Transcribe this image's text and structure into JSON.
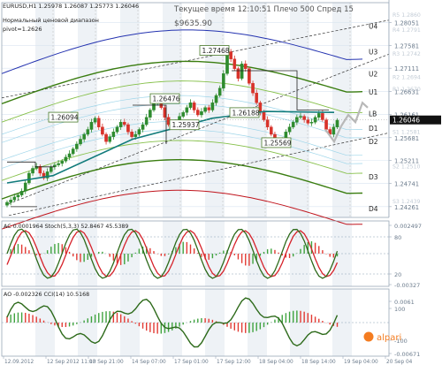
{
  "colors": {
    "bull": "#2e8b2e",
    "bear": "#d8322a",
    "up_wick": "#2e8b2e",
    "grid": "#d9e4f0",
    "band_outer": "#2433b0",
    "band_green": "#3a7d10",
    "band_red": "#c0141c",
    "lb_teal": "#117b7b",
    "label_border": "#4a7a2a",
    "axis_text": "#6b7b8c"
  },
  "header": {
    "symbol_line": "EURUSD,H1  1.25978 1.26087 1.25773 1.26046",
    "indicator_name": "Нормальный ценовой диапазон",
    "pivot_line": "pivot=1.2626",
    "top_info": "Текущее время 12:10:51 Плечо 500 Спред 15",
    "balance": "$9635.90"
  },
  "level_labels": [
    "U4",
    "U3",
    "U2",
    "U1",
    "LB",
    "D1",
    "D2",
    "D3",
    "D4"
  ],
  "price_labels": [
    {
      "text": "R5 1.2860",
      "kind": "faint"
    },
    {
      "text": "1.28051",
      "kind": "tick"
    },
    {
      "text": "R4 1.2791",
      "kind": "faint"
    },
    {
      "text": "1.27581",
      "kind": "tick"
    },
    {
      "text": "R3 1.2742",
      "kind": "faint"
    },
    {
      "text": "1.27111",
      "kind": "tick"
    },
    {
      "text": "R2 1.2694",
      "kind": "faint"
    },
    {
      "text": "1.26631",
      "kind": "tick"
    },
    {
      "text": "R1 1.2670",
      "kind": "faint"
    },
    {
      "text": "1.26161",
      "kind": "tick"
    },
    {
      "text": "1.26046",
      "kind": "current"
    },
    {
      "text": "1.25681",
      "kind": "tick"
    },
    {
      "text": "S1 1.2581",
      "kind": "faint"
    },
    {
      "text": "1.25211",
      "kind": "tick"
    },
    {
      "text": "S2 1.2510",
      "kind": "faint"
    },
    {
      "text": "1.24741",
      "kind": "tick"
    },
    {
      "text": "S3 1.2439",
      "kind": "faint"
    },
    {
      "text": "1.24261",
      "kind": "tick"
    }
  ],
  "callouts": [
    {
      "text": "1.27468"
    },
    {
      "text": "1.26094"
    },
    {
      "text": "1.26476"
    },
    {
      "text": "1.25937"
    },
    {
      "text": "1.26188"
    },
    {
      "text": "1.25569"
    }
  ],
  "chart_data": {
    "type": "line",
    "title": "EURUSD,H1",
    "last_price": 1.26046,
    "pivot": 1.2626,
    "pivot_levels": {
      "R5": 1.286,
      "R4": 1.2791,
      "R3": 1.2742,
      "R2": 1.2694,
      "R1": 1.267,
      "S1": 1.2581,
      "S2": 1.251,
      "S3": 1.2439
    },
    "price_ticks": [
      1.28051,
      1.27581,
      1.27111,
      1.26631,
      1.26161,
      1.25681,
      1.25211,
      1.24741,
      1.24261
    ],
    "ylim": [
      1.2404,
      1.2846
    ],
    "series": [
      {
        "values": [
          1.2435,
          1.244,
          1.2446,
          1.245,
          1.2458,
          1.2475,
          1.2495,
          1.2505,
          1.2509,
          1.2495,
          1.2485,
          1.2498,
          1.2508,
          1.2512,
          1.2515,
          1.252,
          1.2528,
          1.2535,
          1.2545,
          1.2555,
          1.2565,
          1.2575,
          1.2585,
          1.26,
          1.2608,
          1.259,
          1.2575,
          1.256,
          1.257,
          1.258,
          1.259,
          1.26,
          1.2595,
          1.258,
          1.257,
          1.2575,
          1.2585,
          1.2595,
          1.261,
          1.2625,
          1.264,
          1.2645,
          1.263,
          1.261,
          1.2595,
          1.259,
          1.26,
          1.2612,
          1.262,
          1.263,
          1.264,
          1.2625,
          1.2615,
          1.2622,
          1.263,
          1.2625,
          1.264,
          1.2655,
          1.267,
          1.27,
          1.2745,
          1.273,
          1.271,
          1.269,
          1.272,
          1.271,
          1.268,
          1.266,
          1.264,
          1.262,
          1.2605,
          1.259,
          1.2575,
          1.256,
          1.2557,
          1.2565,
          1.258,
          1.259,
          1.26,
          1.261,
          1.2612,
          1.2605,
          1.2598,
          1.26,
          1.261,
          1.2618,
          1.2605,
          1.2585,
          1.2575,
          1.259,
          1.2604
        ]
      }
    ],
    "panels": [
      {
        "label": "AC",
        "value_text": "AC 0.0001964  Stoch(5,3,3) 52.8467 45.5389",
        "ticks": [
          "0.002497",
          "80",
          "20",
          "-0.00327"
        ]
      },
      {
        "label": "AO",
        "value_text": "AO -0.002326  CCI(14) 10.5168",
        "ticks": [
          "0.0061",
          "100",
          "-100",
          "-0.00671"
        ]
      }
    ],
    "x_ticks": [
      "12.09.2012",
      "12 Sep 2012 11:00",
      "13 Sep 21:00",
      "14 Sep 07:00",
      "17 Sep 01:00",
      "17 Sep 12:00",
      "18 Sep 04:00",
      "18 Sep 14:00",
      "19 Sep 04:00",
      "20 Sep 04"
    ]
  },
  "brand": "alpari"
}
